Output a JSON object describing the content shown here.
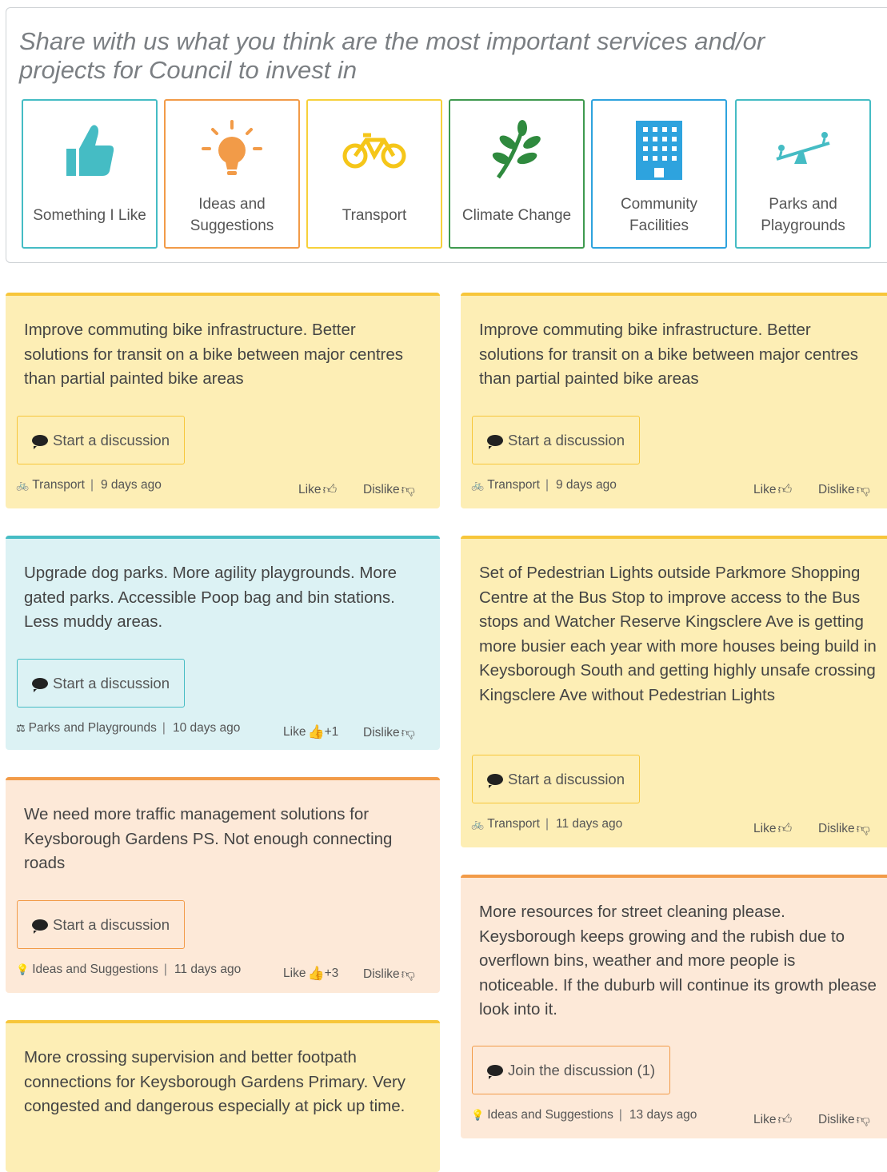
{
  "prompt": "Share with us what you think are the most important services and/or projects for Council to invest in",
  "categories": [
    {
      "label": "Something I Like",
      "icon": "thumbs-up-icon",
      "color": "#45bcc4"
    },
    {
      "label": "Ideas and Suggestions",
      "icon": "lightbulb-icon",
      "color": "#f29b48"
    },
    {
      "label": "Transport",
      "icon": "bicycle-icon",
      "color": "#f7d13b"
    },
    {
      "label": "Climate Change",
      "icon": "leaf-icon",
      "color": "#3f9a4f"
    },
    {
      "label": "Community Facilities",
      "icon": "building-icon",
      "color": "#2ea3de"
    },
    {
      "label": "Parks and Playgrounds",
      "icon": "seesaw-icon",
      "color": "#45bcc4"
    }
  ],
  "cards": [
    {
      "text": "Improve commuting bike infrastructure. Better solutions for transit on a bike between major centres than partial painted bike areas",
      "button": "Start a discussion",
      "category": "Transport",
      "category_icon": "bicycle-icon",
      "time": "9 days ago",
      "like": "Like",
      "like_count": "",
      "dislike": "Dislike",
      "bg": "#fdeeb5",
      "accent": "#f7c63a"
    },
    {
      "text": "Improve commuting bike infrastructure. Better solutions for transit on a bike between major centres than partial painted bike areas",
      "button": "Start a discussion",
      "category": "Transport",
      "category_icon": "bicycle-icon",
      "time": "9 days ago",
      "like": "Like",
      "like_count": "",
      "dislike": "Dislike",
      "bg": "#fdeeb5",
      "accent": "#f7c63a"
    },
    {
      "text": "Upgrade dog parks. More agility playgrounds. More gated parks. Accessible Poop bag and bin stations. Less muddy areas.",
      "button": "Start a discussion",
      "category": "Parks and Playgrounds",
      "category_icon": "seesaw-icon",
      "time": "10 days ago",
      "like": "Like",
      "like_count": "+1",
      "dislike": "Dislike",
      "bg": "#dcf2f4",
      "accent": "#45bcc4"
    },
    {
      "text": "Set of Pedestrian Lights outside Parkmore Shopping Centre at the Bus Stop to improve access to the Bus stops and Watcher Reserve Kingsclere Ave is getting more busier each year with more houses being build in Keysborough South and getting highly unsafe crossing Kingsclere Ave without Pedestrian Lights",
      "button": "Start a discussion",
      "category": "Transport",
      "category_icon": "bicycle-icon",
      "time": "11 days ago",
      "like": "Like",
      "like_count": "",
      "dislike": "Dislike",
      "bg": "#fdeeb5",
      "accent": "#f7c63a"
    },
    {
      "text": "We need more traffic management solutions for Keysborough Gardens PS. Not enough connecting roads",
      "button": "Start a discussion",
      "category": "Ideas and Suggestions",
      "category_icon": "lightbulb-icon",
      "time": "11 days ago",
      "like": "Like",
      "like_count": "+3",
      "dislike": "Dislike",
      "bg": "#fde9d8",
      "accent": "#f29b48"
    },
    {
      "text": "More resources for street cleaning please. Keysborough keeps growing and the rubish due to overflown bins, weather and more people is noticeable. If the duburb will continue its growth please look into it.",
      "button": "Join the discussion (1)",
      "category": "Ideas and Suggestions",
      "category_icon": "lightbulb-icon",
      "time": "13 days ago",
      "like": "Like",
      "like_count": "",
      "dislike": "Dislike",
      "bg": "#fde9d8",
      "accent": "#f29b48"
    },
    {
      "text": "More crossing supervision and better footpath connections for Keysborough Gardens Primary. Very congested and dangerous especially at pick up time.",
      "button": "",
      "category": "",
      "category_icon": "",
      "time": "",
      "like": "",
      "like_count": "",
      "dislike": "",
      "bg": "#fdeeb5",
      "accent": "#f7c63a"
    }
  ]
}
